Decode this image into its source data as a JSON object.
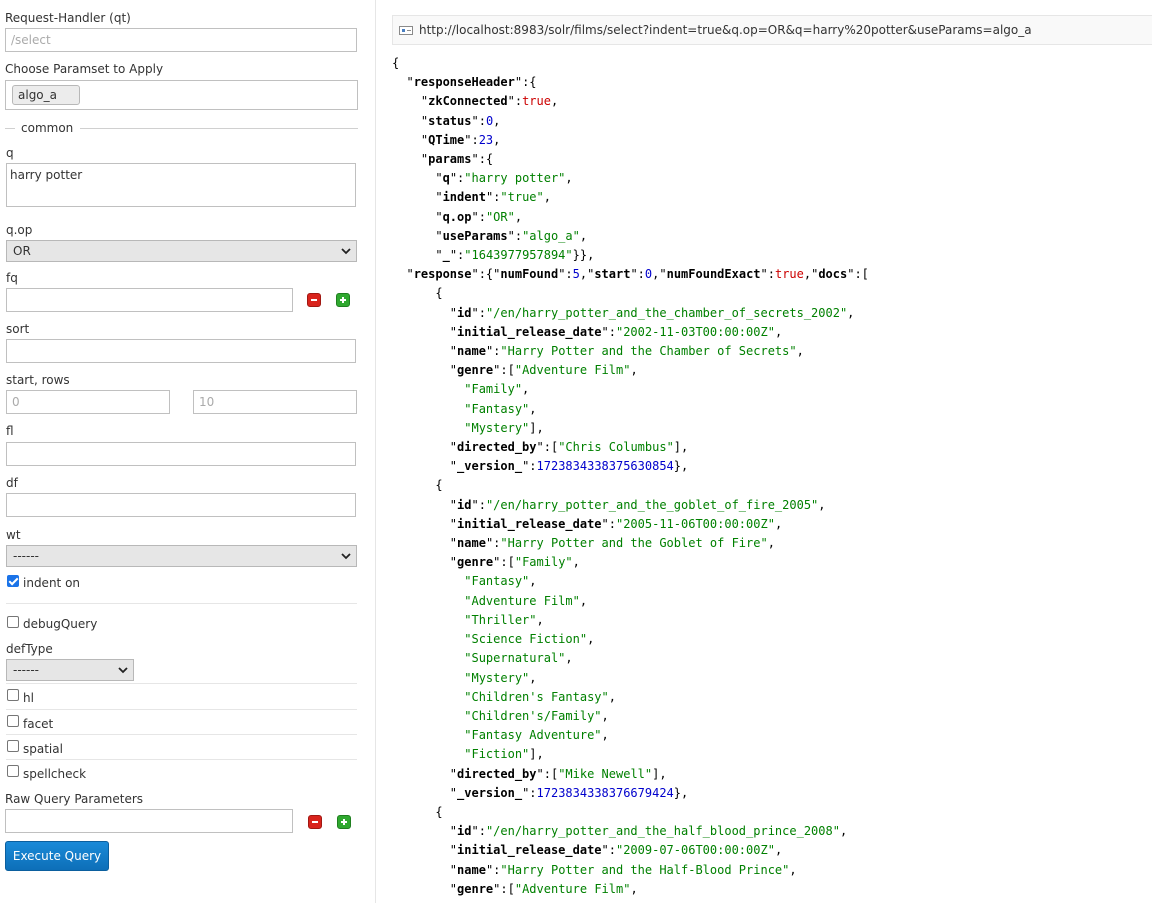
{
  "form": {
    "qt_label": "Request-Handler (qt)",
    "qt_placeholder": "/select",
    "paramset_label": "Choose Paramset to Apply",
    "paramset_value": "algo_a",
    "common_legend": "common",
    "q_label": "q",
    "q_value": "harry potter",
    "qop_label": "q.op",
    "qop_value": "OR",
    "fq_label": "fq",
    "fq_value": "",
    "sort_label": "sort",
    "sort_value": "",
    "startrows_label": "start, rows",
    "start_placeholder": "0",
    "rows_placeholder": "10",
    "fl_label": "fl",
    "df_label": "df",
    "wt_label": "wt",
    "wt_value": "------",
    "indent_label": "indent on",
    "indent_checked": true,
    "debugquery_label": "debugQuery",
    "deftype_label": "defType",
    "deftype_value": "------",
    "hl_label": "hl",
    "facet_label": "facet",
    "spatial_label": "spatial",
    "spellcheck_label": "spellcheck",
    "raw_label": "Raw Query Parameters",
    "raw_value": "",
    "execute_label": "Execute Query"
  },
  "result": {
    "url": "http://localhost:8983/solr/films/select?indent=true&q.op=OR&q=harry%20potter&useParams=algo_a",
    "lines": [
      [
        [
          "p",
          "{"
        ]
      ],
      [
        [
          "p",
          "  \""
        ],
        [
          "k",
          "responseHeader"
        ],
        [
          "p",
          "\":{"
        ]
      ],
      [
        [
          "p",
          "    \""
        ],
        [
          "k",
          "zkConnected"
        ],
        [
          "p",
          "\":"
        ],
        [
          "b",
          "true"
        ],
        [
          "p",
          ","
        ]
      ],
      [
        [
          "p",
          "    \""
        ],
        [
          "k",
          "status"
        ],
        [
          "p",
          "\":"
        ],
        [
          "n",
          "0"
        ],
        [
          "p",
          ","
        ]
      ],
      [
        [
          "p",
          "    \""
        ],
        [
          "k",
          "QTime"
        ],
        [
          "p",
          "\":"
        ],
        [
          "n",
          "23"
        ],
        [
          "p",
          ","
        ]
      ],
      [
        [
          "p",
          "    \""
        ],
        [
          "k",
          "params"
        ],
        [
          "p",
          "\":{"
        ]
      ],
      [
        [
          "p",
          "      \""
        ],
        [
          "k",
          "q"
        ],
        [
          "p",
          "\":"
        ],
        [
          "s",
          "\"harry potter\""
        ],
        [
          "p",
          ","
        ]
      ],
      [
        [
          "p",
          "      \""
        ],
        [
          "k",
          "indent"
        ],
        [
          "p",
          "\":"
        ],
        [
          "s",
          "\"true\""
        ],
        [
          "p",
          ","
        ]
      ],
      [
        [
          "p",
          "      \""
        ],
        [
          "k",
          "q.op"
        ],
        [
          "p",
          "\":"
        ],
        [
          "s",
          "\"OR\""
        ],
        [
          "p",
          ","
        ]
      ],
      [
        [
          "p",
          "      \""
        ],
        [
          "k",
          "useParams"
        ],
        [
          "p",
          "\":"
        ],
        [
          "s",
          "\"algo_a\""
        ],
        [
          "p",
          ","
        ]
      ],
      [
        [
          "p",
          "      \""
        ],
        [
          "k",
          "_"
        ],
        [
          "p",
          "\":"
        ],
        [
          "s",
          "\"1643977957894\""
        ],
        [
          "p",
          "}},"
        ]
      ],
      [
        [
          "p",
          "  \""
        ],
        [
          "k",
          "response"
        ],
        [
          "p",
          "\":{\""
        ],
        [
          "k",
          "numFound"
        ],
        [
          "p",
          "\":"
        ],
        [
          "n",
          "5"
        ],
        [
          "p",
          ",\""
        ],
        [
          "k",
          "start"
        ],
        [
          "p",
          "\":"
        ],
        [
          "n",
          "0"
        ],
        [
          "p",
          ",\""
        ],
        [
          "k",
          "numFoundExact"
        ],
        [
          "p",
          "\":"
        ],
        [
          "b",
          "true"
        ],
        [
          "p",
          ",\""
        ],
        [
          "k",
          "docs"
        ],
        [
          "p",
          "\":["
        ]
      ],
      [
        [
          "p",
          "      {"
        ]
      ],
      [
        [
          "p",
          "        \""
        ],
        [
          "k",
          "id"
        ],
        [
          "p",
          "\":"
        ],
        [
          "s",
          "\"/en/harry_potter_and_the_chamber_of_secrets_2002\""
        ],
        [
          "p",
          ","
        ]
      ],
      [
        [
          "p",
          "        \""
        ],
        [
          "k",
          "initial_release_date"
        ],
        [
          "p",
          "\":"
        ],
        [
          "s",
          "\"2002-11-03T00:00:00Z\""
        ],
        [
          "p",
          ","
        ]
      ],
      [
        [
          "p",
          "        \""
        ],
        [
          "k",
          "name"
        ],
        [
          "p",
          "\":"
        ],
        [
          "s",
          "\"Harry Potter and the Chamber of Secrets\""
        ],
        [
          "p",
          ","
        ]
      ],
      [
        [
          "p",
          "        \""
        ],
        [
          "k",
          "genre"
        ],
        [
          "p",
          "\":["
        ],
        [
          "s",
          "\"Adventure Film\""
        ],
        [
          "p",
          ","
        ]
      ],
      [
        [
          "p",
          "          "
        ],
        [
          "s",
          "\"Family\""
        ],
        [
          "p",
          ","
        ]
      ],
      [
        [
          "p",
          "          "
        ],
        [
          "s",
          "\"Fantasy\""
        ],
        [
          "p",
          ","
        ]
      ],
      [
        [
          "p",
          "          "
        ],
        [
          "s",
          "\"Mystery\""
        ],
        [
          "p",
          "],"
        ]
      ],
      [
        [
          "p",
          "        \""
        ],
        [
          "k",
          "directed_by"
        ],
        [
          "p",
          "\":["
        ],
        [
          "s",
          "\"Chris Columbus\""
        ],
        [
          "p",
          "],"
        ]
      ],
      [
        [
          "p",
          "        \""
        ],
        [
          "k",
          "_version_"
        ],
        [
          "p",
          "\":"
        ],
        [
          "n",
          "1723834338375630854"
        ],
        [
          "p",
          "},"
        ]
      ],
      [
        [
          "p",
          "      {"
        ]
      ],
      [
        [
          "p",
          "        \""
        ],
        [
          "k",
          "id"
        ],
        [
          "p",
          "\":"
        ],
        [
          "s",
          "\"/en/harry_potter_and_the_goblet_of_fire_2005\""
        ],
        [
          "p",
          ","
        ]
      ],
      [
        [
          "p",
          "        \""
        ],
        [
          "k",
          "initial_release_date"
        ],
        [
          "p",
          "\":"
        ],
        [
          "s",
          "\"2005-11-06T00:00:00Z\""
        ],
        [
          "p",
          ","
        ]
      ],
      [
        [
          "p",
          "        \""
        ],
        [
          "k",
          "name"
        ],
        [
          "p",
          "\":"
        ],
        [
          "s",
          "\"Harry Potter and the Goblet of Fire\""
        ],
        [
          "p",
          ","
        ]
      ],
      [
        [
          "p",
          "        \""
        ],
        [
          "k",
          "genre"
        ],
        [
          "p",
          "\":["
        ],
        [
          "s",
          "\"Family\""
        ],
        [
          "p",
          ","
        ]
      ],
      [
        [
          "p",
          "          "
        ],
        [
          "s",
          "\"Fantasy\""
        ],
        [
          "p",
          ","
        ]
      ],
      [
        [
          "p",
          "          "
        ],
        [
          "s",
          "\"Adventure Film\""
        ],
        [
          "p",
          ","
        ]
      ],
      [
        [
          "p",
          "          "
        ],
        [
          "s",
          "\"Thriller\""
        ],
        [
          "p",
          ","
        ]
      ],
      [
        [
          "p",
          "          "
        ],
        [
          "s",
          "\"Science Fiction\""
        ],
        [
          "p",
          ","
        ]
      ],
      [
        [
          "p",
          "          "
        ],
        [
          "s",
          "\"Supernatural\""
        ],
        [
          "p",
          ","
        ]
      ],
      [
        [
          "p",
          "          "
        ],
        [
          "s",
          "\"Mystery\""
        ],
        [
          "p",
          ","
        ]
      ],
      [
        [
          "p",
          "          "
        ],
        [
          "s",
          "\"Children's Fantasy\""
        ],
        [
          "p",
          ","
        ]
      ],
      [
        [
          "p",
          "          "
        ],
        [
          "s",
          "\"Children's/Family\""
        ],
        [
          "p",
          ","
        ]
      ],
      [
        [
          "p",
          "          "
        ],
        [
          "s",
          "\"Fantasy Adventure\""
        ],
        [
          "p",
          ","
        ]
      ],
      [
        [
          "p",
          "          "
        ],
        [
          "s",
          "\"Fiction\""
        ],
        [
          "p",
          "],"
        ]
      ],
      [
        [
          "p",
          "        \""
        ],
        [
          "k",
          "directed_by"
        ],
        [
          "p",
          "\":["
        ],
        [
          "s",
          "\"Mike Newell\""
        ],
        [
          "p",
          "],"
        ]
      ],
      [
        [
          "p",
          "        \""
        ],
        [
          "k",
          "_version_"
        ],
        [
          "p",
          "\":"
        ],
        [
          "n",
          "1723834338376679424"
        ],
        [
          "p",
          "},"
        ]
      ],
      [
        [
          "p",
          "      {"
        ]
      ],
      [
        [
          "p",
          "        \""
        ],
        [
          "k",
          "id"
        ],
        [
          "p",
          "\":"
        ],
        [
          "s",
          "\"/en/harry_potter_and_the_half_blood_prince_2008\""
        ],
        [
          "p",
          ","
        ]
      ],
      [
        [
          "p",
          "        \""
        ],
        [
          "k",
          "initial_release_date"
        ],
        [
          "p",
          "\":"
        ],
        [
          "s",
          "\"2009-07-06T00:00:00Z\""
        ],
        [
          "p",
          ","
        ]
      ],
      [
        [
          "p",
          "        \""
        ],
        [
          "k",
          "name"
        ],
        [
          "p",
          "\":"
        ],
        [
          "s",
          "\"Harry Potter and the Half-Blood Prince\""
        ],
        [
          "p",
          ","
        ]
      ],
      [
        [
          "p",
          "        \""
        ],
        [
          "k",
          "genre"
        ],
        [
          "p",
          "\":["
        ],
        [
          "s",
          "\"Adventure Film\""
        ],
        [
          "p",
          ","
        ]
      ]
    ]
  }
}
